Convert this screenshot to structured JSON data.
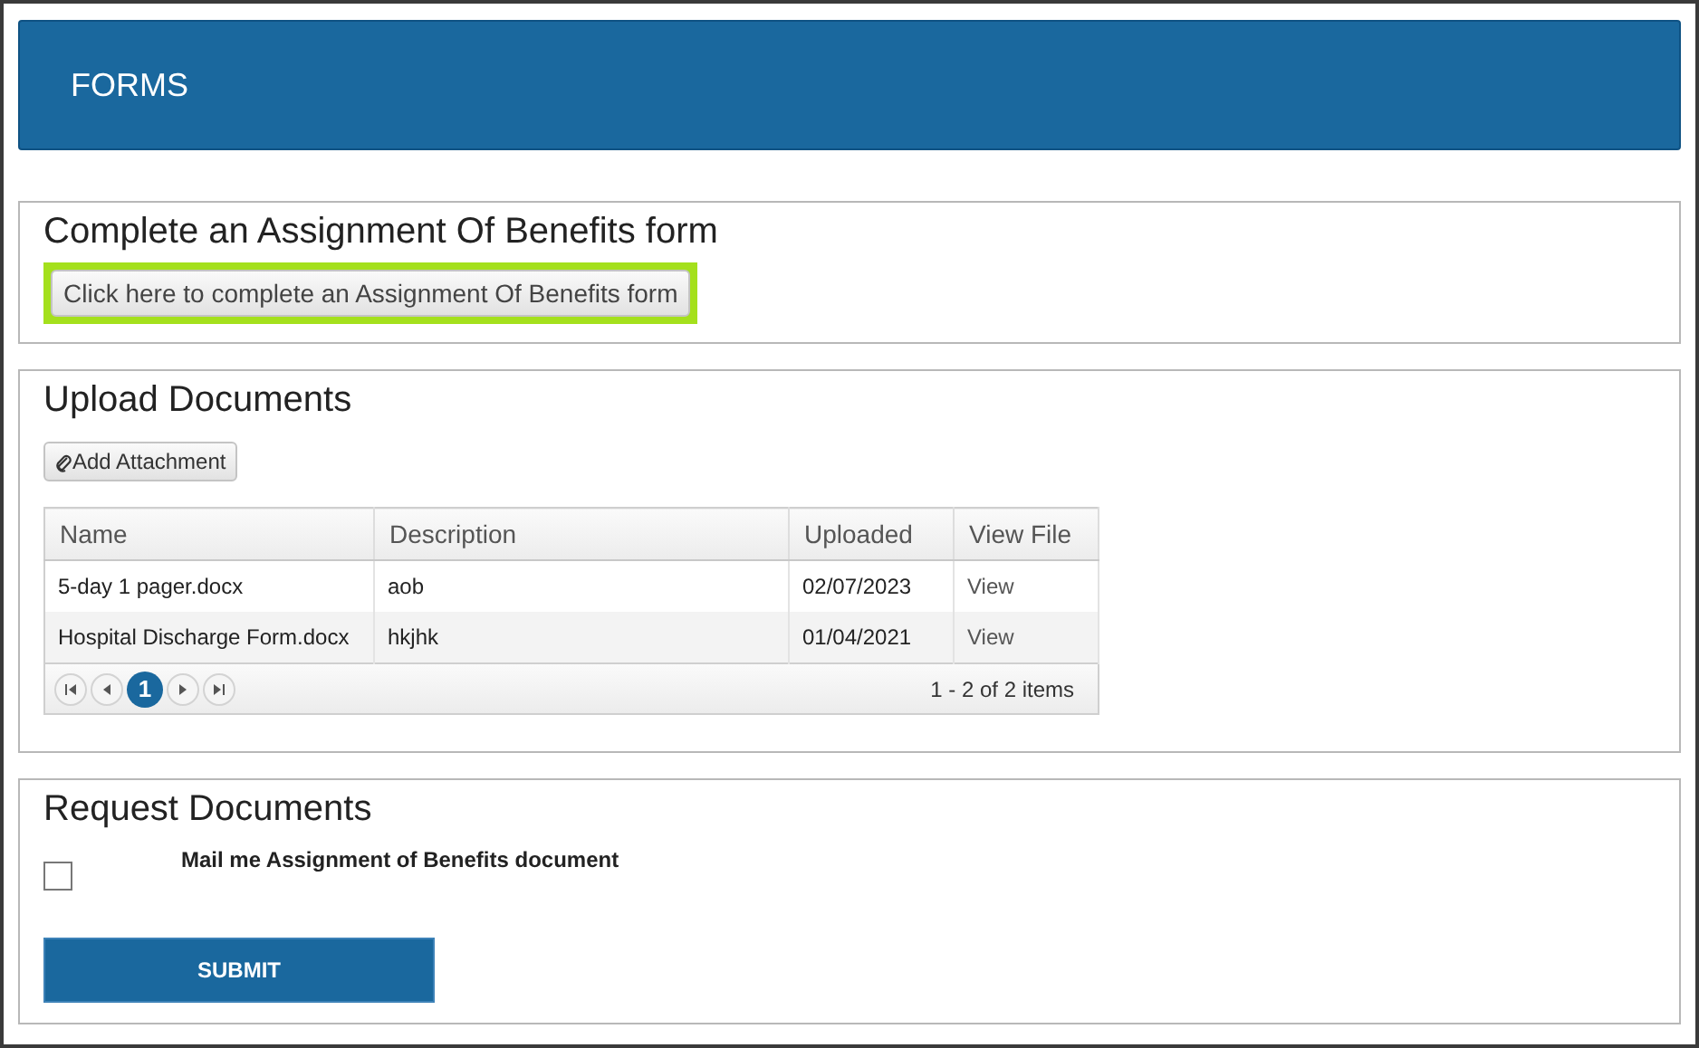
{
  "header": {
    "title": "FORMS"
  },
  "aob_section": {
    "title": "Complete an Assignment Of Benefits form",
    "button": "Click here to complete an Assignment Of Benefits form",
    "highlighted": true
  },
  "upload_section": {
    "title": "Upload Documents",
    "add_button": "Add Attachment",
    "table": {
      "columns": [
        "Name",
        "Description",
        "Uploaded",
        "View File"
      ],
      "rows": [
        {
          "name": "5-day 1 pager.docx",
          "description": "aob",
          "uploaded": "02/07/2023",
          "view": "View"
        },
        {
          "name": "Hospital Discharge Form.docx",
          "description": "hkjhk",
          "uploaded": "01/04/2021",
          "view": "View"
        }
      ]
    },
    "pager": {
      "pages": [
        {
          "label": "1",
          "selected": true
        }
      ],
      "summary": "1 - 2 of 2 items"
    }
  },
  "request_section": {
    "title": "Request Documents",
    "checkbox": {
      "label": "Mail me Assignment of Benefits document",
      "checked": false
    },
    "submit": "SUBMIT"
  }
}
